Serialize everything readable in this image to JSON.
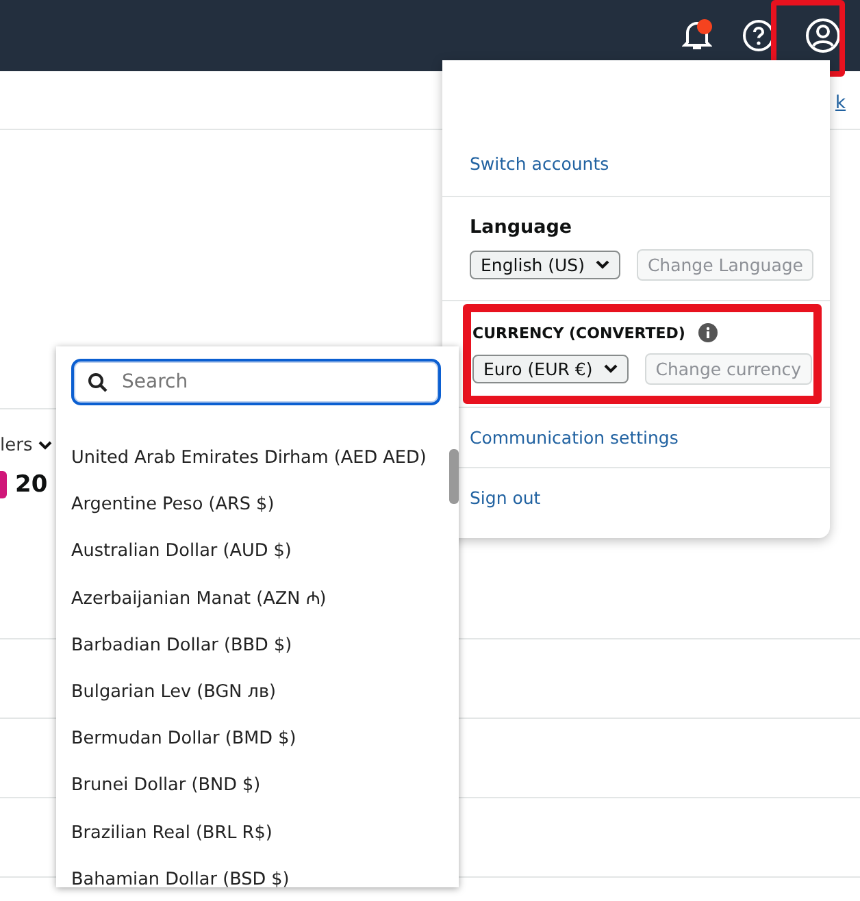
{
  "topbar": {
    "notification_badge": true
  },
  "page": {
    "filter_label": "lers",
    "count": "20",
    "link": "k"
  },
  "account_menu": {
    "switch_accounts": "Switch accounts",
    "language_heading": "Language",
    "language_value": "English (US)",
    "change_language": "Change Language",
    "currency_heading": "CURRENCY (CONVERTED)",
    "currency_value": "Euro (EUR €)",
    "change_currency": "Change currency",
    "communication_settings": "Communication settings",
    "sign_out": "Sign out"
  },
  "currency_picker": {
    "search": {
      "placeholder": "Search"
    },
    "options": [
      "United Arab Emirates Dirham (AED AED)",
      "Argentine Peso (ARS $)",
      "Australian Dollar (AUD $)",
      "Azerbaijanian Manat (AZN ₼)",
      "Barbadian Dollar (BBD $)",
      "Bulgarian Lev (BGN лв)",
      "Bermudan Dollar (BMD $)",
      "Brunei Dollar (BND $)",
      "Brazilian Real (BRL R$)",
      "Bahamian Dollar (BSD $)"
    ]
  }
}
